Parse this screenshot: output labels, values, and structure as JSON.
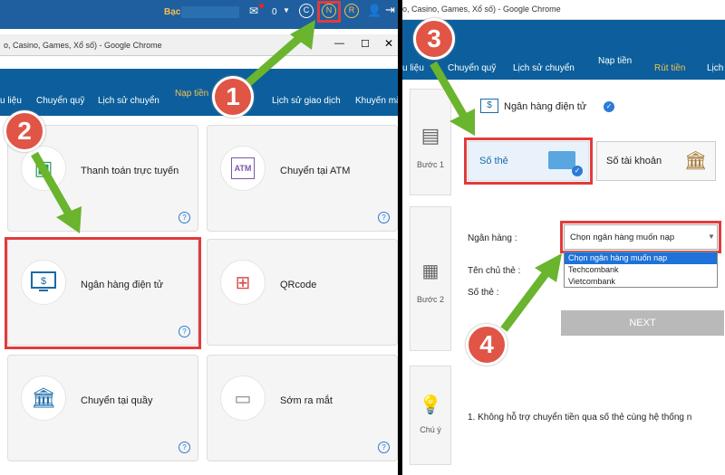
{
  "left": {
    "topbar": {
      "bac_label": "Bạc",
      "coin_count": "0",
      "coins": [
        "C",
        "N",
        "R"
      ]
    },
    "window": {
      "title": "o, Casino, Games, Xổ số) - Google Chrome"
    },
    "nav": [
      "u liệu",
      "Chuyển quỹ",
      "Lịch sử chuyển",
      "Nạp tiền",
      "Lịch sử giao dịch",
      "Khuyến mã"
    ],
    "cards": [
      {
        "label": "Thanh toán trực tuyến"
      },
      {
        "label": "Chuyển tại ATM"
      },
      {
        "label": "Ngân hàng điện tử"
      },
      {
        "label": "QRcode"
      },
      {
        "label": "Chuyển tại quầy"
      },
      {
        "label": "Sớm ra mắt"
      }
    ],
    "atm_text": "ATM",
    "help": "?",
    "markers": [
      "1",
      "2"
    ]
  },
  "right": {
    "window": {
      "title": "o, Casino, Games, Xổ số) - Google Chrome"
    },
    "nav": [
      "u liệu",
      "Chuyển quỹ",
      "Lịch sử chuyển",
      "Nạp tiền",
      "Rút tiền",
      "Lịch"
    ],
    "method_title": "Ngân hàng điện tử",
    "step1": "Bước 1",
    "step2": "Bước 2",
    "note_step": "Chú ý",
    "opt_card": "Số thẻ",
    "opt_account": "Số tài khoản",
    "bank_label": "Ngân hàng :",
    "holder_label": "Tên chủ thẻ :",
    "card_label": "Số thẻ :",
    "select_value": "Chọn ngân hàng muốn nạp",
    "options": [
      "Chọn ngân hàng muốn nạp",
      "Techcombank",
      "Vietcombank"
    ],
    "next": "NEXT",
    "note": "1.  Không hỗ trợ chuyển tiền qua số thẻ cùng hệ thống n",
    "markers": [
      "3",
      "4"
    ]
  }
}
